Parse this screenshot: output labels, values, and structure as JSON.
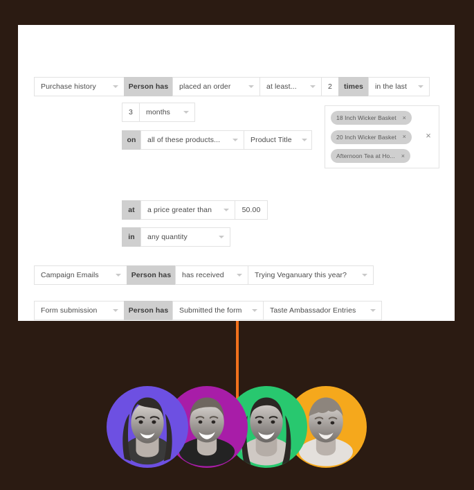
{
  "theme": {
    "page_background": "#2b1b12",
    "card_background": "#ffffff",
    "connector_color": "#f2711c",
    "fixed_pill_color": "#cfcfcf",
    "tag_color": "#cfcfcf",
    "border_color": "#e2e2e2",
    "text_color": "#4a4a4a"
  },
  "builder": {
    "rows": {
      "purchase_history": {
        "source_label": "Purchase history",
        "person_has_label": "Person has",
        "action_label": "placed an order",
        "frequency_label": "at least...",
        "count_value": "2",
        "times_label": "times",
        "timeframe_label": "in the last"
      },
      "duration": {
        "number_value": "3",
        "unit_label": "months"
      },
      "products": {
        "prefix_label": "on",
        "match_label": "all of these products...",
        "field_label": "Product Title",
        "tags": [
          {
            "label": "18 Inch Wicker Basket",
            "remove": "×"
          },
          {
            "label": "20 Inch Wicker Basket",
            "remove": "×"
          },
          {
            "label": "Afternoon Tea at Ho...",
            "remove": "×"
          }
        ],
        "clear_icon": "×"
      },
      "price": {
        "prefix_label": "at",
        "comparator_label": "a price greater than",
        "amount_value": "50.00"
      },
      "quantity": {
        "prefix_label": "in",
        "quantity_label": "any quantity"
      },
      "campaign_emails": {
        "source_label": "Campaign Emails",
        "person_has_label": "Person has",
        "action_label": "has received",
        "target_label": "Trying Veganuary this year?"
      },
      "form_submission": {
        "source_label": "Form submission",
        "person_has_label": "Person has",
        "action_label": "Submitted the form",
        "target_label": "Taste Ambassador Entries"
      }
    }
  },
  "audience": {
    "avatars": [
      {
        "name": "avatar-person-1",
        "ring_color": "#6d50e2"
      },
      {
        "name": "avatar-person-2",
        "ring_color": "#a81da8"
      },
      {
        "name": "avatar-person-3",
        "ring_color": "#28c86f"
      },
      {
        "name": "avatar-person-4",
        "ring_color": "#f5a81c"
      }
    ]
  }
}
